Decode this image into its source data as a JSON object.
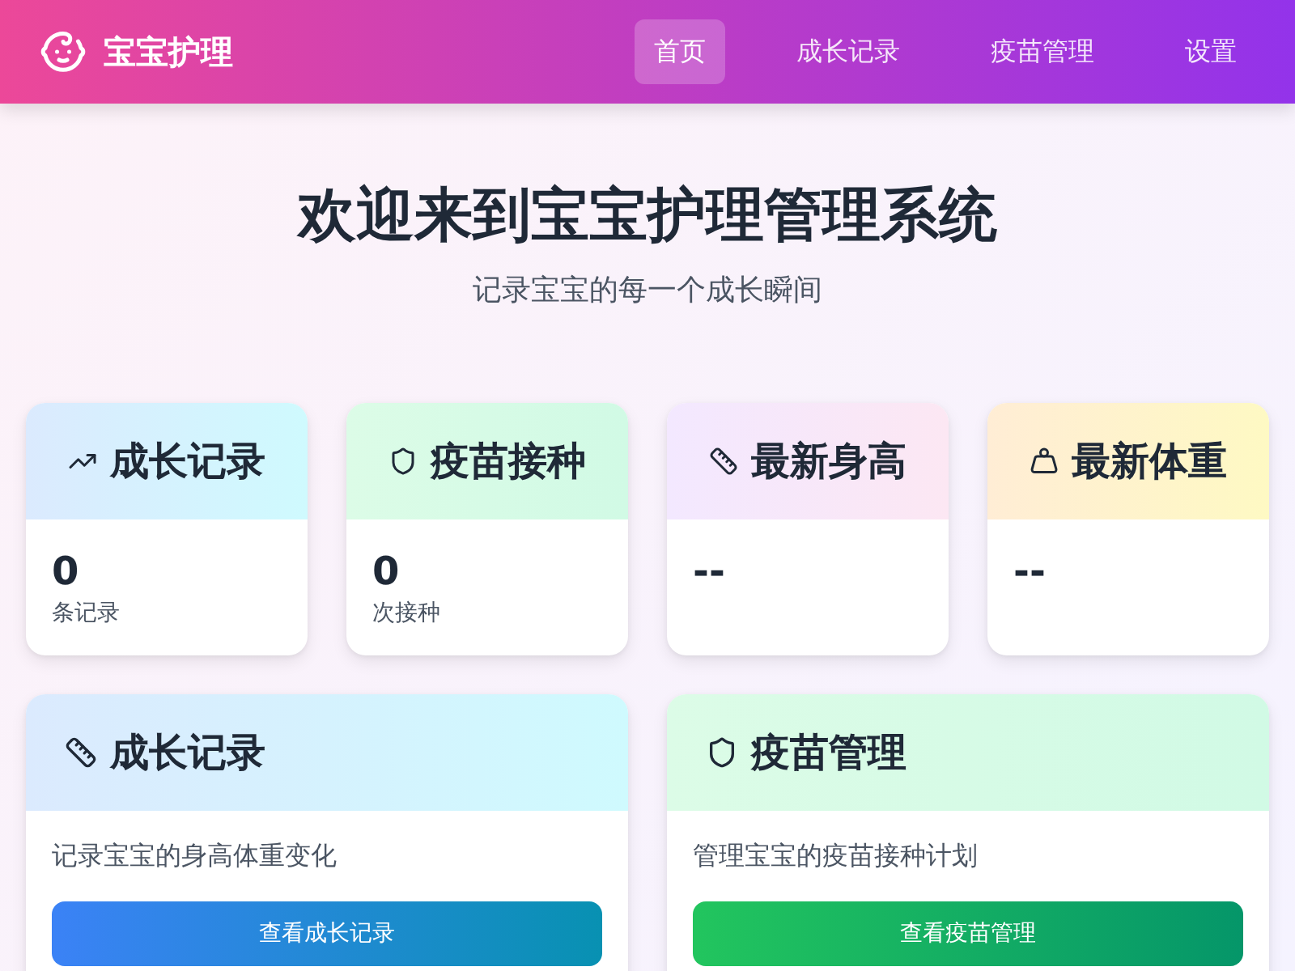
{
  "header": {
    "brand": "宝宝护理",
    "nav": [
      {
        "label": "首页",
        "selected": true
      },
      {
        "label": "成长记录",
        "selected": false
      },
      {
        "label": "疫苗管理",
        "selected": false
      },
      {
        "label": "设置",
        "selected": false
      }
    ]
  },
  "hero": {
    "title": "欢迎来到宝宝护理管理系统",
    "subtitle": "记录宝宝的每一个成长瞬间"
  },
  "stats": [
    {
      "kind": "growth",
      "title": "成长记录",
      "value": "0",
      "unit": "条记录"
    },
    {
      "kind": "vaccine",
      "title": "疫苗接种",
      "value": "0",
      "unit": "次接种"
    },
    {
      "kind": "height",
      "title": "最新身高",
      "value": "--"
    },
    {
      "kind": "weight",
      "title": "最新体重",
      "value": "--"
    }
  ],
  "features": [
    {
      "kind": "growth",
      "title": "成长记录",
      "description": "记录宝宝的身高体重变化",
      "button": "查看成长记录"
    },
    {
      "kind": "vaccine",
      "title": "疫苗管理",
      "description": "管理宝宝的疫苗接种计划",
      "button": "查看疫苗管理"
    }
  ]
}
